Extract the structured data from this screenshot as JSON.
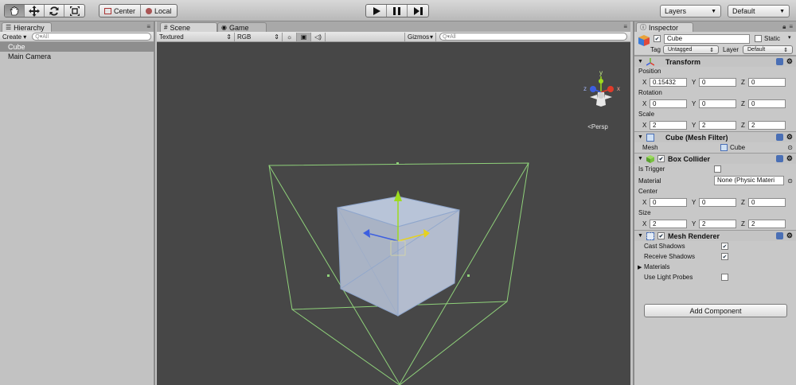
{
  "toolbar": {
    "tools": [
      "hand-tool-icon",
      "move-tool-icon",
      "rotate-tool-icon",
      "scale-tool-icon"
    ],
    "pivot_label": "Center",
    "space_label": "Local",
    "layers_label": "Layers",
    "layout_label": "Default"
  },
  "hierarchy": {
    "tab_label": "Hierarchy",
    "create_label": "Create",
    "search_placeholder": "Q▾All",
    "items": [
      {
        "label": "Cube",
        "selected": true
      },
      {
        "label": "Main Camera",
        "selected": false
      }
    ]
  },
  "scene": {
    "tabs": [
      {
        "label": "Scene"
      },
      {
        "label": "Game"
      }
    ],
    "render_mode": "Textured",
    "color_mode": "RGB",
    "gizmos_label": "Gizmos",
    "search_placeholder": "Q▾All",
    "persp_label": "Persp",
    "colors": {
      "background": "#474747",
      "wire": "#8fd17a",
      "x_axis": "#e03b2a",
      "y_axis": "#9ddb1e",
      "z_axis": "#3d5fe0"
    }
  },
  "inspector": {
    "tab_label": "Inspector",
    "object_name": "Cube",
    "static_label": "Static",
    "tag_label": "Tag",
    "tag_value": "Untagged",
    "layer_label": "Layer",
    "layer_value": "Default",
    "transform": {
      "title": "Transform",
      "position_label": "Position",
      "position": {
        "x": "0.15432",
        "y": "0",
        "z": "0"
      },
      "rotation_label": "Rotation",
      "rotation": {
        "x": "0",
        "y": "0",
        "z": "0"
      },
      "scale_label": "Scale",
      "scale": {
        "x": "2",
        "y": "2",
        "z": "2"
      }
    },
    "mesh_filter": {
      "title": "Cube (Mesh Filter)",
      "mesh_label": "Mesh",
      "mesh_value": "Cube"
    },
    "box_collider": {
      "title": "Box Collider",
      "is_trigger_label": "Is Trigger",
      "material_label": "Material",
      "material_value": "None (Physic Materi",
      "center_label": "Center",
      "center": {
        "x": "0",
        "y": "0",
        "z": "0"
      },
      "size_label": "Size",
      "size": {
        "x": "2",
        "y": "2",
        "z": "2"
      }
    },
    "mesh_renderer": {
      "title": "Mesh Renderer",
      "cast_shadows_label": "Cast Shadows",
      "receive_shadows_label": "Receive Shadows",
      "materials_label": "Materials",
      "light_probes_label": "Use Light Probes"
    },
    "add_component_label": "Add Component",
    "axis_labels": {
      "x": "X",
      "y": "Y",
      "z": "Z"
    }
  }
}
